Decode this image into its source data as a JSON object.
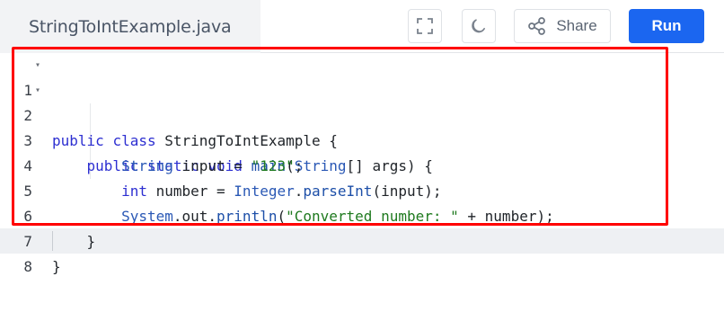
{
  "tab": {
    "filename": "StringToIntExample.java"
  },
  "toolbar": {
    "fullscreen_icon": "fullscreen-icon",
    "theme_icon": "moon-icon",
    "share_label": "Share",
    "share_icon": "share-icon",
    "run_label": "Run"
  },
  "editor": {
    "line_numbers": [
      "1",
      "2",
      "3",
      "4",
      "5",
      "6",
      "7",
      "8"
    ],
    "lines": [
      "public class StringToIntExample {",
      "    public static void main(String[] args) {",
      "        String input = \"123\";",
      "        int number = Integer.parseInt(input);",
      "        System.out.println(\"Converted number: \" + number);",
      "    }",
      "}",
      ""
    ],
    "fold_marker": "▾"
  },
  "colors": {
    "run_button": "#1b66f0",
    "highlight_border": "#ff0000",
    "keyword": "#2d2fd1",
    "string": "#1f7a1f"
  }
}
